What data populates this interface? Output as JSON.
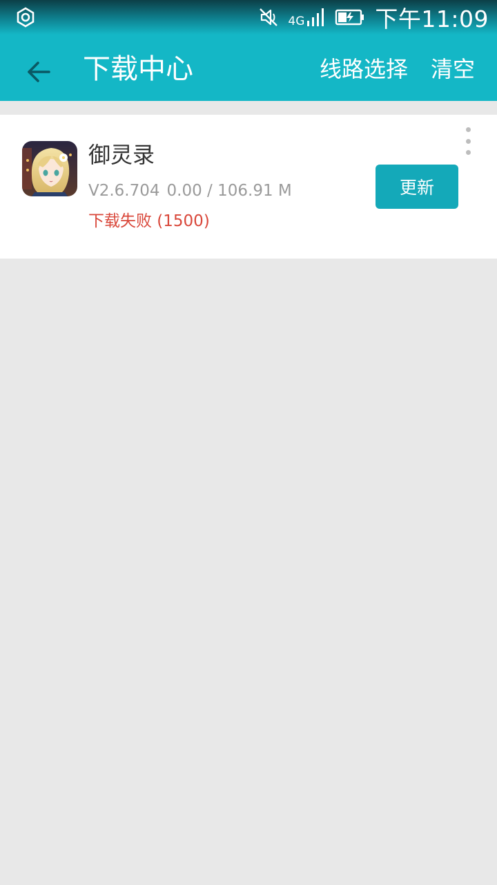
{
  "status_bar": {
    "left_icon": "settings-hexagon-icon",
    "icons": [
      "mute-icon",
      "signal-4g-icon",
      "battery-charging-icon"
    ],
    "network_label": "4G",
    "time": "下午11:09"
  },
  "app_bar": {
    "back_icon": "arrow-left-icon",
    "title": "下载中心",
    "actions": {
      "route_select": "线路选择",
      "clear": "清空"
    }
  },
  "downloads": [
    {
      "name": "御灵录",
      "version": "V2.6.704",
      "progress_text": "0.00 / 106.91 M",
      "progress_fraction": 0.0,
      "status_text": "下载失败 (1500)",
      "action_label": "更新",
      "more_icon": "more-vertical-icon"
    }
  ],
  "colors": {
    "accent": "#14b7c6",
    "button": "#14a9b9",
    "error": "#d9473a",
    "background": "#e8e8e8"
  }
}
